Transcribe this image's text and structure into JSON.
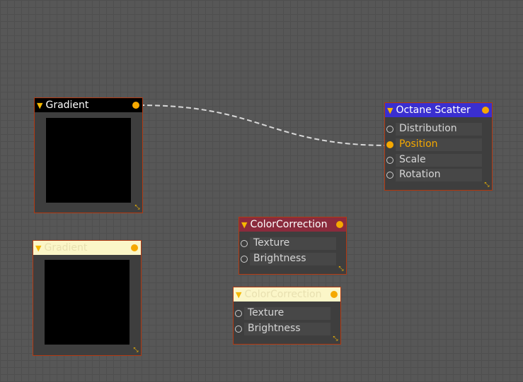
{
  "nodes": {
    "gradient_1": {
      "title": "Gradient"
    },
    "gradient_2": {
      "title": "Gradient"
    },
    "octane_scatter": {
      "title": "Octane Scatter",
      "pins": [
        "Distribution",
        "Position",
        "Scale",
        "Rotation"
      ],
      "connected_pin": "Position"
    },
    "color_correction_1": {
      "title": "ColorCorrection",
      "pins": [
        "Texture",
        "Brightness"
      ]
    },
    "color_correction_2": {
      "title": "ColorCorrection",
      "pins": [
        "Texture",
        "Brightness"
      ]
    }
  },
  "connections": [
    {
      "from": "Gradient",
      "to": "Octane Scatter.Position"
    }
  ],
  "colors": {
    "grid_background": "#575757",
    "node_border": "#b33a12",
    "accent_orange": "#f5a800",
    "header_blue": "#3a2fd0",
    "header_maroon": "#8a2b3c",
    "header_cream": "#fbf6c8",
    "wire": "#d8d8d8"
  },
  "icons": {
    "collapse": "triangle-down-icon",
    "resize": "expand-arrows-icon"
  }
}
